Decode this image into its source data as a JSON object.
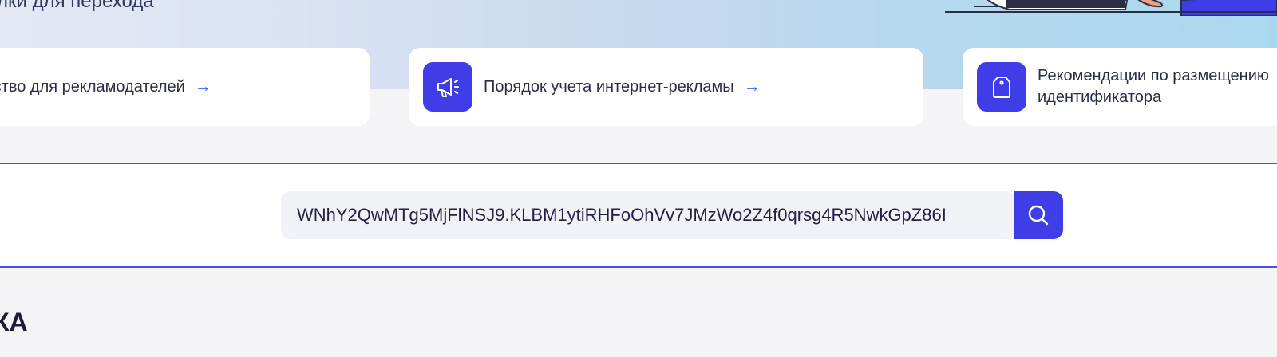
{
  "hero": {
    "subtitle": "лки для перехода"
  },
  "cards": [
    {
      "label": "дство для рекламодателей",
      "arrow": "→"
    },
    {
      "label": "Порядок учета интернет-рекламы",
      "arrow": "→",
      "icon": "megaphone-icon"
    },
    {
      "label": "Рекомендации по размещению идентификатора",
      "icon": "tag-icon"
    }
  ],
  "search": {
    "value": "WNhY2QwMTg5MjFlNSJ9.KLBM1ytiRHFoOhVv7JMzWo2Z4f0qrsg4R5NwkGpZ86I",
    "icon": "search-icon"
  },
  "section": {
    "heading": "КА"
  },
  "colors": {
    "accent": "#3f3de8",
    "link_arrow": "#2f6ff0",
    "divider": "#4b4de0"
  }
}
